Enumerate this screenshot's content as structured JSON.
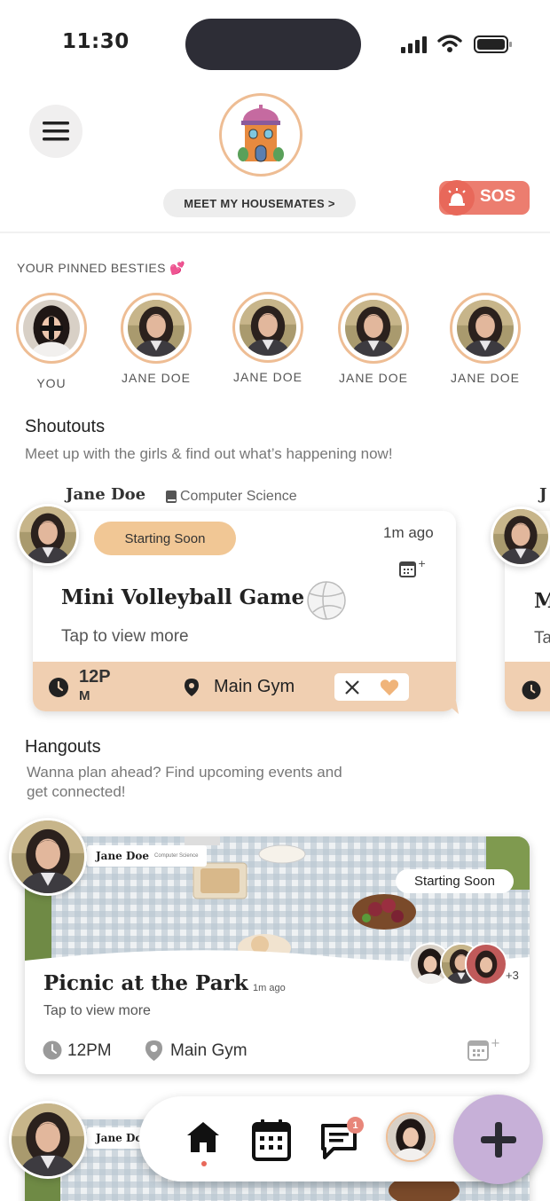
{
  "status_bar": {
    "time": "11:30"
  },
  "header": {
    "housemates_label": "MEET MY HOUSEMATES >",
    "sos_label": "SOS"
  },
  "besties": {
    "title": "YOUR PINNED BESTIES 💕",
    "items": [
      {
        "name": "YOU"
      },
      {
        "name": "JANE  DOE"
      },
      {
        "name": "JANE  DOE"
      },
      {
        "name": "JANE  DOE"
      },
      {
        "name": "JANE  DOE"
      }
    ]
  },
  "shoutouts": {
    "title": "Shoutouts",
    "subtitle": "Meet up with the girls & find out what’s happening now!",
    "card": {
      "author": "Jane Doe",
      "major": "Computer Science",
      "status": "Starting Soon",
      "time_ago": "1m ago",
      "title": "Mini Volleyball Game",
      "tap_more": "Tap to view more",
      "time_line1": "12P",
      "time_line2": "M",
      "location": "Main Gym"
    },
    "peek_author_initial": "J",
    "peek_title_initial": "M",
    "peek_tap_initial": "Ta"
  },
  "hangouts": {
    "title": "Hangouts",
    "subtitle_line1": "Wanna plan ahead? Find upcoming events and",
    "subtitle_line2": "get connected!",
    "card": {
      "author": "Jane Doe",
      "major": "Computer Science",
      "status": "Starting Soon",
      "title": "Picnic at the Park",
      "time_ago": "1m ago",
      "tap_more": "Tap to view more",
      "attendees_more": "+3",
      "time": "12PM",
      "location": "Main Gym"
    },
    "card2_author": "Jane Do"
  },
  "nav": {
    "badge_count": "1",
    "items": [
      "home-icon",
      "calendar-icon",
      "chat-icon",
      "profile-avatar"
    ]
  },
  "colors": {
    "accent_peach": "#eebd94",
    "sos_red": "#ec7d6f",
    "status_pill": "#f1c795",
    "footer_peach": "#f0cfb1",
    "fab_lavender": "#c7b0d8"
  }
}
